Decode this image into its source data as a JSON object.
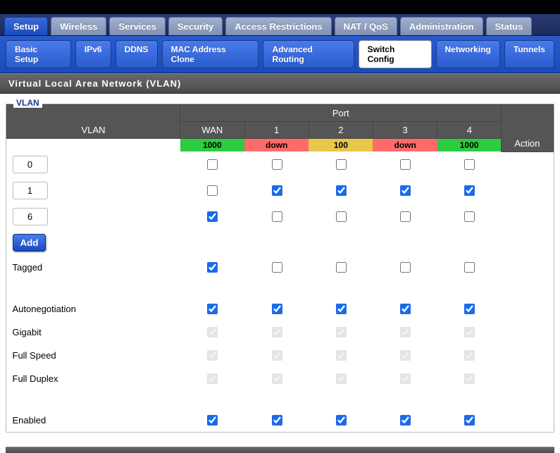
{
  "primary_tabs": {
    "items": [
      "Setup",
      "Wireless",
      "Services",
      "Security",
      "Access Restrictions",
      "NAT / QoS",
      "Administration",
      "Status"
    ],
    "active": 0
  },
  "secondary_tabs": {
    "items": [
      "Basic Setup",
      "IPv6",
      "DDNS",
      "MAC Address Clone",
      "Advanced Routing",
      "Switch Config",
      "Networking",
      "Tunnels"
    ],
    "active": 5
  },
  "section_title": "Virtual Local Area Network (VLAN)",
  "fieldset_title": "VLAN",
  "table": {
    "head": {
      "vlan": "VLAN",
      "port": "Port",
      "action": "Action",
      "cols": [
        "WAN",
        "1",
        "2",
        "3",
        "4"
      ]
    },
    "status": [
      {
        "label": "1000",
        "class": "st-up"
      },
      {
        "label": "down",
        "class": "st-down"
      },
      {
        "label": "100",
        "class": "st-100"
      },
      {
        "label": "down",
        "class": "st-down"
      },
      {
        "label": "1000",
        "class": "st-up"
      }
    ],
    "vlans": [
      {
        "id": "0",
        "checks": [
          false,
          false,
          false,
          false,
          false
        ]
      },
      {
        "id": "1",
        "checks": [
          false,
          true,
          true,
          true,
          true
        ]
      },
      {
        "id": "6",
        "checks": [
          true,
          false,
          false,
          false,
          false
        ]
      }
    ],
    "add_label": "Add",
    "rows": [
      {
        "label": "Tagged",
        "checks": [
          true,
          false,
          false,
          false,
          false
        ],
        "disabled": false
      },
      {
        "label": "Autonegotiation",
        "checks": [
          true,
          true,
          true,
          true,
          true
        ],
        "disabled": false
      },
      {
        "label": "Gigabit",
        "checks": [
          true,
          true,
          true,
          true,
          true
        ],
        "disabled": true
      },
      {
        "label": "Full Speed",
        "checks": [
          true,
          true,
          true,
          true,
          true
        ],
        "disabled": true
      },
      {
        "label": "Full Duplex",
        "checks": [
          true,
          true,
          true,
          true,
          true
        ],
        "disabled": true
      },
      {
        "label": "Enabled",
        "checks": [
          true,
          true,
          true,
          true,
          true
        ],
        "disabled": false
      }
    ]
  }
}
